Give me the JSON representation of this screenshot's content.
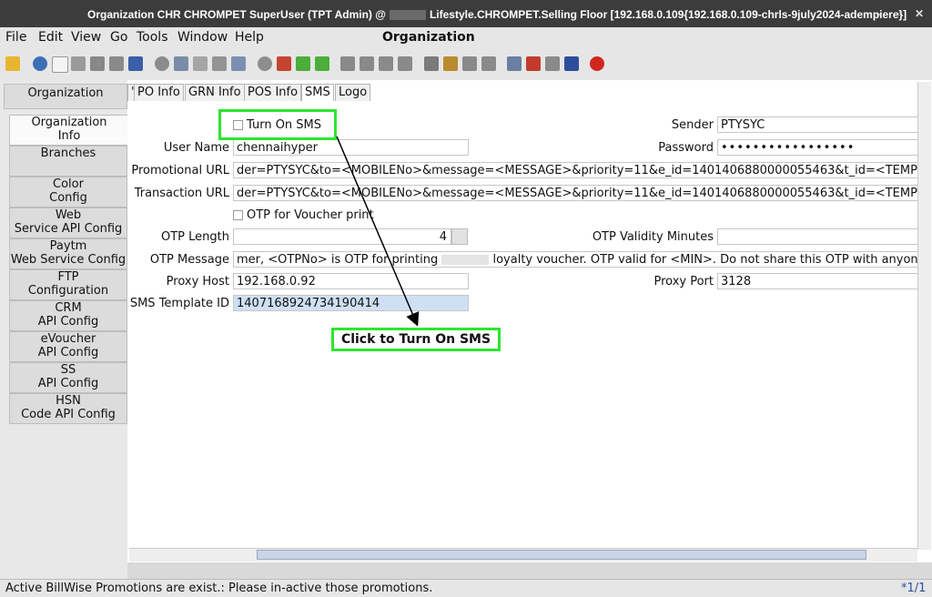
{
  "window": {
    "title_prefix": "Organization  CHR  CHROMPET  SuperUser (TPT Admin) @",
    "title_suffix": "Lifestyle.CHROMPET.Selling Floor [192.168.0.109{192.168.0.109-chrls-9july2024-adempiere}]",
    "title": "Organization",
    "controls": [
      "–",
      "▫",
      "✕"
    ]
  },
  "menu": {
    "file": "File",
    "edit": "Edit",
    "view": "View",
    "go": "Go",
    "tools": "Tools",
    "window": "Window",
    "help": "Help"
  },
  "toolbar": {
    "icons": [
      "undo-icon",
      "help-icon",
      "new-icon",
      "copy-icon",
      "delete-icon",
      "delete-selection-icon",
      "save-icon",
      "refresh-icon",
      "find-icon",
      "attachment-icon",
      "chat-icon",
      "history-icon",
      "home-icon",
      "menu-icon",
      "back-icon",
      "forward-icon",
      "first-record-icon",
      "previous-record-icon",
      "next-record-icon",
      "last-record-icon",
      "report-icon",
      "archive-icon",
      "print-preview-icon",
      "print-icon",
      "zoom-across-icon",
      "request-icon",
      "product-info-icon",
      "workflow-icon",
      "exit-icon"
    ]
  },
  "sidebar": {
    "items": [
      {
        "l1": "Organization",
        "l2": ""
      },
      {
        "l1": "Organization",
        "l2": "Info"
      },
      {
        "l1": "Branches",
        "l2": ""
      },
      {
        "l1": "Color",
        "l2": "Config"
      },
      {
        "l1": "Web",
        "l2": "Service API Config"
      },
      {
        "l1": "Paytm",
        "l2": "Web Service Config"
      },
      {
        "l1": "FTP",
        "l2": "Configuration"
      },
      {
        "l1": "CRM",
        "l2": "API Config"
      },
      {
        "l1": "eVoucher",
        "l2": "API Config"
      },
      {
        "l1": "SS",
        "l2": "API Config"
      },
      {
        "l1": "HSN",
        "l2": "Code API Config"
      }
    ]
  },
  "tabs": {
    "prev": "'",
    "po_info": "PO Info",
    "grn_info": "GRN Info",
    "pos_info": "POS Info",
    "sms": "SMS",
    "logo": "Logo"
  },
  "form": {
    "turn_on_sms": "Turn On SMS",
    "sender_label": "Sender",
    "sender_value": "PTYSYC",
    "user_name_label": "User Name",
    "user_name_value": "chennaihyper",
    "password_label": "Password",
    "password_value": "•••••••••••••••••",
    "promotional_url_label": "Promotional URL",
    "promotional_url_value": "der=PTYSYC&to=<MOBILENo>&message=<MESSAGE>&priority=11&e_id=1401406880000055463&t_id=<TEMPLAT",
    "transaction_url_label": "Transaction URL",
    "transaction_url_value": "der=PTYSYC&to=<MOBILENo>&message=<MESSAGE>&priority=11&e_id=1401406880000055463&t_id=<TEMPLAT",
    "otp_voucher_label": "OTP for Voucher print",
    "otp_length_label": "OTP Length",
    "otp_length_value": "4",
    "otp_validity_label": "OTP Validity Minutes",
    "otp_validity_value": "",
    "otp_message_label": "OTP Message",
    "otp_message_pre": "mer, <OTPNo> is OTP for printing",
    "otp_message_post": "loyalty voucher. OTP valid for <MIN>. Do not share this OTP with anyone. PC",
    "proxy_host_label": "Proxy Host",
    "proxy_host_value": "192.168.0.92",
    "proxy_port_label": "Proxy Port",
    "proxy_port_value": "3128",
    "sms_template_label": "SMS Template ID",
    "sms_template_value": "1407168924734190414"
  },
  "annotation": {
    "callout_text": "Click to Turn On SMS",
    "color": "#2ee52e"
  },
  "status": {
    "message": "Active BillWise Promotions are exist.: Please in-active those promotions.",
    "record": "*1/1"
  }
}
